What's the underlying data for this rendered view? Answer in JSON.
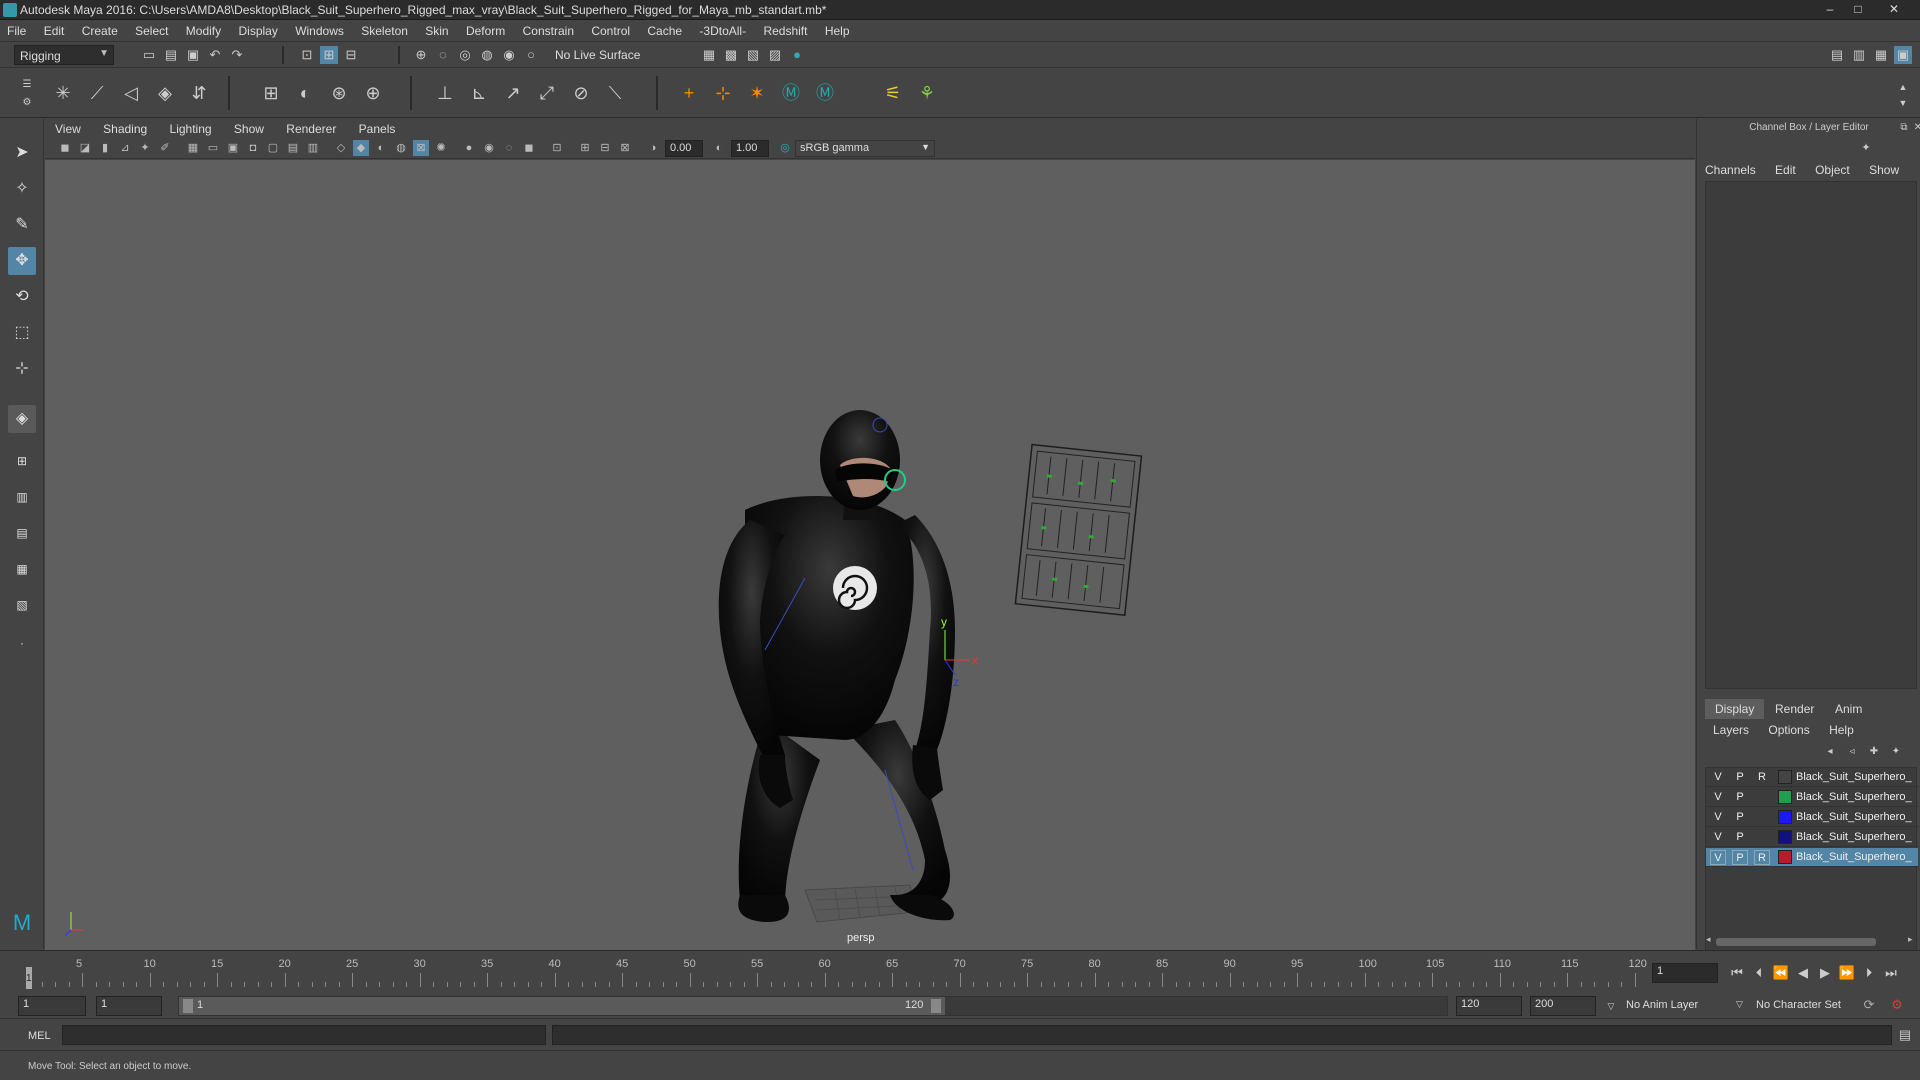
{
  "window": {
    "title": "Autodesk Maya 2016: C:\\Users\\AMDA8\\Desktop\\Black_Suit_Superhero_Rigged_max_vray\\Black_Suit_Superhero_Rigged_for_Maya_mb_standart.mb*",
    "minimize": "–",
    "maximize": "□",
    "close": "✕"
  },
  "menubar": [
    "File",
    "Edit",
    "Create",
    "Select",
    "Modify",
    "Display",
    "Windows",
    "Skeleton",
    "Skin",
    "Deform",
    "Constrain",
    "Control",
    "Cache",
    "-3DtoAll-",
    "Redshift",
    "Help"
  ],
  "statusline": {
    "menuset": "Rigging",
    "live_surface": "No Live Surface"
  },
  "viewport": {
    "menu": [
      "View",
      "Shading",
      "Lighting",
      "Show",
      "Renderer",
      "Panels"
    ],
    "exposure": "0.00",
    "gamma": "1.00",
    "colorspace": "sRGB gamma",
    "camera_label": "persp",
    "axis_labels": {
      "x": "x",
      "y": "y",
      "z": "z"
    }
  },
  "channelbox": {
    "title": "Channel Box / Layer Editor",
    "menu": [
      "Channels",
      "Edit",
      "Object",
      "Show"
    ],
    "tabs": [
      "Display",
      "Render",
      "Anim"
    ],
    "layer_menu": [
      "Layers",
      "Options",
      "Help"
    ],
    "layers": [
      {
        "v": "V",
        "p": "P",
        "r": "R",
        "color": "#444444",
        "name": "Black_Suit_Superhero_",
        "selected": false
      },
      {
        "v": "V",
        "p": "P",
        "r": "",
        "color": "#1fa050",
        "name": "Black_Suit_Superhero_",
        "selected": false
      },
      {
        "v": "V",
        "p": "P",
        "r": "",
        "color": "#1a1aee",
        "name": "Black_Suit_Superhero_",
        "selected": false
      },
      {
        "v": "V",
        "p": "P",
        "r": "",
        "color": "#101080",
        "name": "Black_Suit_Superhero_",
        "selected": false
      },
      {
        "v": "V",
        "p": "P",
        "r": "R",
        "color": "#c0182a",
        "name": "Black_Suit_Superhero_",
        "selected": true
      }
    ]
  },
  "timeline": {
    "ticks": [
      "5",
      "10",
      "15",
      "20",
      "25",
      "30",
      "35",
      "40",
      "45",
      "50",
      "55",
      "60",
      "65",
      "70",
      "75",
      "80",
      "85",
      "90",
      "95",
      "100",
      "105",
      "110",
      "115",
      "120"
    ],
    "current_frame_marker": "1",
    "current_frame_field": "1"
  },
  "range": {
    "start": "1",
    "playback_start": "1",
    "slider_start": "1",
    "slider_end": "120",
    "playback_end": "120",
    "end": "200",
    "anim_layer": "No Anim Layer",
    "character_set": "No Character Set"
  },
  "cmdline": {
    "label": "MEL"
  },
  "helpline": {
    "text": "Move Tool: Select an object to move."
  }
}
